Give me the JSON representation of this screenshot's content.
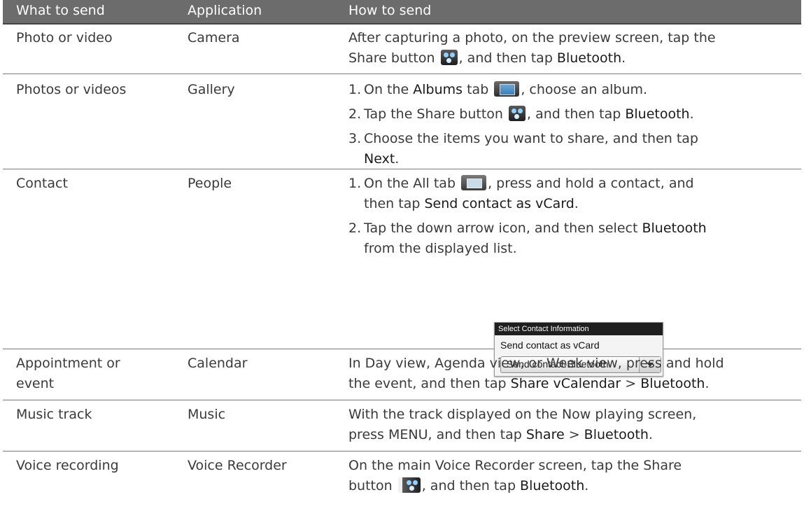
{
  "header": {
    "col1": "What to send",
    "col2": "Application",
    "col3": "How to send"
  },
  "rows": [
    {
      "what": "Photo or video",
      "app": "Camera",
      "p1": "After capturing a photo, on the preview screen, tap the",
      "p2a": "Share button",
      "p2b": ", and then tap",
      "p2c": "Bluetooth",
      "p2d": "."
    },
    {
      "what": "Photos or videos",
      "app": "Gallery",
      "s1n": "1.",
      "s1a": "On the",
      "s1b": "Albums",
      "s1c": "tab",
      "s1d": ", choose an album.",
      "s2n": "2.",
      "s2a": "Tap the Share button",
      "s2b": ", and then tap",
      "s2c": "Bluetooth",
      "s2d": ".",
      "s3n": "3.",
      "s3a": "Choose the items you want to share, and then tap",
      "s3b": "Next",
      "s3c": "."
    },
    {
      "what": "Contact",
      "app": "People",
      "s1n": "1.",
      "s1a": "On the All tab",
      "s1b": ", press and hold a contact, and",
      "s1c": "then tap",
      "s1d": "Send contact as vCard",
      "s1e": ".",
      "s2n": "2.",
      "s2a": "Tap the down arrow icon, and then select",
      "s2b": "Bluetooth",
      "s2c": "from the displayed list.",
      "dialog": {
        "title": "Select Contact Information",
        "label": "Send contact as vCard",
        "selected": "Send contact-Bluetooth"
      }
    },
    {
      "what1": "Appointment or",
      "what2": "event",
      "app": "Calendar",
      "p1": "In Day view, Agenda view, or Week view, press and hold",
      "p2a": "the event, and then tap",
      "p2b": "Share vCalendar",
      "p2c": " > ",
      "p2d": "Bluetooth",
      "p2e": "."
    },
    {
      "what": "Music track",
      "app": "Music",
      "p1": "With the track displayed on the Now playing screen,",
      "p2a": "press MENU, and then tap",
      "p2b": "Share",
      "p2c": " > ",
      "p2d": "Bluetooth",
      "p2e": "."
    },
    {
      "what": "Voice recording",
      "app": "Voice Recorder",
      "p1": "On the main Voice Recorder screen, tap the Share",
      "p2a": "button",
      "p2b": ", and then tap",
      "p2c": "Bluetooth",
      "p2d": "."
    }
  ],
  "icons": {
    "share": "share-icon",
    "albums": "albums-tab-icon",
    "all": "all-tab-icon"
  }
}
